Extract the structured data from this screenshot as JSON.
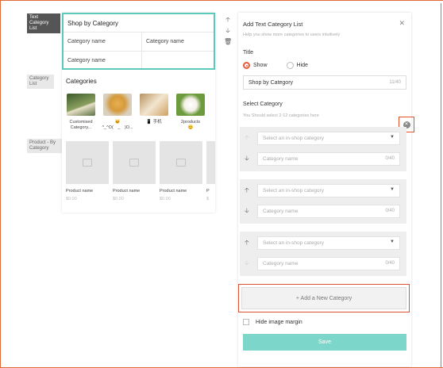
{
  "sidebar": {
    "tags": [
      {
        "label": "Text\nCategory\nList",
        "active": true
      },
      {
        "label": "Category\nList",
        "active": false
      },
      {
        "label": "Product - By\nCategory",
        "active": false
      }
    ]
  },
  "preview": {
    "shop_title": "Shop by Category",
    "cells": [
      "Category name",
      "Category name",
      "Category name"
    ],
    "categories_title": "Categories",
    "categories": [
      {
        "label": "Customised\nCategory..."
      },
      {
        "label": "🐱\n^_^O(　_　)O..."
      },
      {
        "label": "📱 手机"
      },
      {
        "label": "2products\n😊"
      }
    ],
    "products": [
      {
        "name": "Product name",
        "price": "$0.00"
      },
      {
        "name": "Product name",
        "price": "$0.00"
      },
      {
        "name": "Product name",
        "price": "$0.00"
      },
      {
        "name": "P",
        "price": "$"
      }
    ]
  },
  "panel": {
    "title": "Add Text Category List",
    "subtitle": "Help you show more categories to users intuitively",
    "close_icon": "close-icon",
    "title_label": "Title",
    "show_label": "Show",
    "hide_label": "Hide",
    "title_value": "Shop by Category",
    "title_count": "11/40",
    "select_label": "Select Category",
    "hint": "You Should select 2-12 categories here",
    "groups": [
      {
        "select_placeholder": "Select an in-shop category",
        "name_placeholder": "Category name",
        "count": "0/40"
      },
      {
        "select_placeholder": "Select an in-shop category",
        "name_placeholder": "Category name",
        "count": "0/40"
      },
      {
        "select_placeholder": "Select an in-shop category",
        "name_placeholder": "Category name",
        "count": "0/40"
      }
    ],
    "add_button": "+ Add a New Category",
    "hide_margin_label": "Hide image margin",
    "save_button": "Save"
  },
  "colors": {
    "accent": "#5cc9ba",
    "highlight": "#e0522f",
    "save": "#7dd6ca"
  }
}
